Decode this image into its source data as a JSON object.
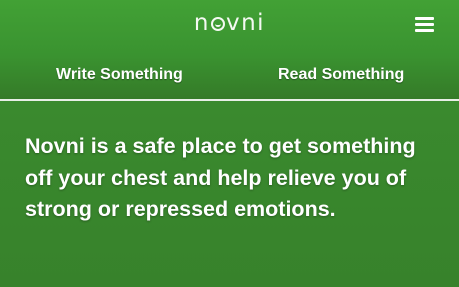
{
  "header": {
    "logo": {
      "prefix": "n",
      "suffix": "vni"
    },
    "menu_icon": "hamburger-menu-icon"
  },
  "nav": {
    "write_label": "Write Something",
    "read_label": "Read Something"
  },
  "main": {
    "intro_text": "Novni is a safe place to get something off your chest and help relieve you of strong or repressed emotions."
  },
  "colors": {
    "header_green": "#42a135",
    "body_green": "#3a8a2e",
    "text": "#ffffff"
  }
}
